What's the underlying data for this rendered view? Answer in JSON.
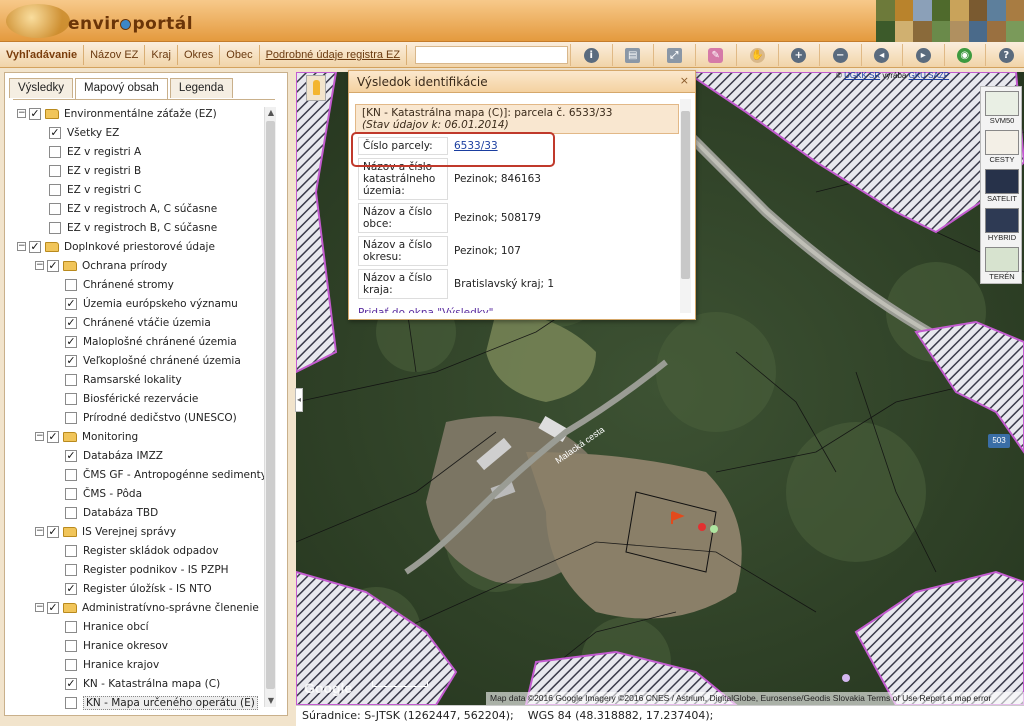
{
  "header": {
    "logo_text_a": "envir",
    "logo_text_b": "portál"
  },
  "toolbar": {
    "tabs": [
      {
        "label": "Vyhľadávanie",
        "style": "bold"
      },
      {
        "label": "Názov EZ",
        "style": ""
      },
      {
        "label": "Kraj",
        "style": ""
      },
      {
        "label": "Okres",
        "style": ""
      },
      {
        "label": "Obec",
        "style": ""
      },
      {
        "label": "Podrobné údaje registra EZ",
        "style": "ul"
      }
    ],
    "search_value": "",
    "tools": [
      {
        "name": "info-icon",
        "glyph": "i",
        "cls": ""
      },
      {
        "name": "print-icon",
        "glyph": "▤",
        "cls": "sq"
      },
      {
        "name": "full-extent-icon",
        "glyph": "⤢",
        "cls": "sq"
      },
      {
        "name": "eraser-icon",
        "glyph": "✎",
        "cls": "pen"
      },
      {
        "name": "pan-hand-icon",
        "glyph": "✋",
        "cls": "hand"
      },
      {
        "name": "zoom-in-icon",
        "glyph": "+",
        "cls": ""
      },
      {
        "name": "zoom-out-icon",
        "glyph": "−",
        "cls": ""
      },
      {
        "name": "zoom-previous-icon",
        "glyph": "◂",
        "cls": ""
      },
      {
        "name": "zoom-next-icon",
        "glyph": "▸",
        "cls": ""
      },
      {
        "name": "globe-icon",
        "glyph": "◉",
        "cls": "gr"
      },
      {
        "name": "help-icon",
        "glyph": "?",
        "cls": ""
      }
    ]
  },
  "left_panel": {
    "tabs": [
      {
        "label": "Výsledky",
        "active": false
      },
      {
        "label": "Mapový obsah",
        "active": true
      },
      {
        "label": "Legenda",
        "active": false
      }
    ],
    "tree": [
      {
        "label": "Environmentálne záťaže (EZ)",
        "level": 0,
        "expander": "−",
        "checked": true,
        "folder": true
      },
      {
        "label": "Všetky EZ",
        "level": 1,
        "checked": true
      },
      {
        "label": "EZ v registri A",
        "level": 1,
        "checked": false
      },
      {
        "label": "EZ v registri B",
        "level": 1,
        "checked": false
      },
      {
        "label": "EZ v registri C",
        "level": 1,
        "checked": false
      },
      {
        "label": "EZ v registroch A, C súčasne",
        "level": 1,
        "checked": false
      },
      {
        "label": "EZ v registroch B, C súčasne",
        "level": 1,
        "checked": false
      },
      {
        "label": "Doplnkové priestorové údaje",
        "level": 0,
        "expander": "−",
        "checked": true,
        "folder": true
      },
      {
        "label": "Ochrana prírody",
        "level": 1,
        "expander": "−",
        "checked": true,
        "folder": true
      },
      {
        "label": "Chránené stromy",
        "level": 2,
        "checked": false
      },
      {
        "label": "Územia európskeho významu",
        "level": 2,
        "checked": true
      },
      {
        "label": "Chránené vtáčie územia",
        "level": 2,
        "checked": true
      },
      {
        "label": "Maloplošné chránené územia",
        "level": 2,
        "checked": true
      },
      {
        "label": "Veľkoplošné chránené územia",
        "level": 2,
        "checked": true
      },
      {
        "label": "Ramsarské lokality",
        "level": 2,
        "checked": false
      },
      {
        "label": "Biosférické rezervácie",
        "level": 2,
        "checked": false
      },
      {
        "label": "Prírodné dedičstvo (UNESCO)",
        "level": 2,
        "checked": false
      },
      {
        "label": "Monitoring",
        "level": 1,
        "expander": "−",
        "checked": true,
        "folder": true
      },
      {
        "label": "Databáza IMZZ",
        "level": 2,
        "checked": true
      },
      {
        "label": "ČMS GF - Antropogénne sedimenty",
        "level": 2,
        "checked": false
      },
      {
        "label": "ČMS - Pôda",
        "level": 2,
        "checked": false
      },
      {
        "label": "Databáza TBD",
        "level": 2,
        "checked": false
      },
      {
        "label": "IS Verejnej správy",
        "level": 1,
        "expander": "−",
        "checked": true,
        "folder": true
      },
      {
        "label": "Register skládok odpadov",
        "level": 2,
        "checked": false
      },
      {
        "label": "Register podnikov - IS PZPH",
        "level": 2,
        "checked": false
      },
      {
        "label": "Register úložísk - IS NTO",
        "level": 2,
        "checked": true
      },
      {
        "label": "Administratívno-správne členenie",
        "level": 1,
        "expander": "−",
        "checked": true,
        "folder": true
      },
      {
        "label": "Hranice obcí",
        "level": 2,
        "checked": false
      },
      {
        "label": "Hranice okresov",
        "level": 2,
        "checked": false
      },
      {
        "label": "Hranice krajov",
        "level": 2,
        "checked": false
      },
      {
        "label": "KN - Katastrálna mapa (C)",
        "level": 2,
        "checked": true
      },
      {
        "label": "KN - Mapa určeného operátu (E)",
        "level": 2,
        "checked": false,
        "selected": true
      }
    ]
  },
  "popup": {
    "title": "Výsledok identifikácie",
    "close": "×",
    "layer_header": "[KN - Katastrálna mapa (C)]: parcela č. 6533/33",
    "layer_status": "(Stav údajov k: 06.01.2014)",
    "rows": [
      {
        "key": "Číslo parcely:",
        "value": "6533/33",
        "link": true
      },
      {
        "key": "Názov a číslo katastrálneho územia:",
        "value": "Pezinok; 846163"
      },
      {
        "key": "Názov a číslo obce:",
        "value": "Pezinok; 508179"
      },
      {
        "key": "Názov a číslo okresu:",
        "value": "Pezinok; 107"
      },
      {
        "key": "Názov a číslo kraja:",
        "value": "Bratislavský kraj; 1"
      }
    ],
    "add_link": "Pridať do okna \"Výsledky\""
  },
  "map": {
    "copyright_prefix": "© ",
    "copyright_link_a": "ÚGKK SR",
    "copyright_mid": " vyrába ",
    "copyright_link_b": "GKÚ SAŽP",
    "road_label": "Malacká cesta",
    "road_number": "503",
    "google": "Google",
    "attribution": "Map data ©2016 Google Imagery ©2016 CNES / Astrium, DigitalGlobe, Eurosense/Geodis Slovakia   Terms of Use   Report a map error",
    "map_types": [
      {
        "label": "SVM50"
      },
      {
        "label": "CESTY"
      },
      {
        "label": "SATELIT"
      },
      {
        "label": "HYBRID"
      },
      {
        "label": "TERÉN"
      }
    ]
  },
  "statusbar": {
    "coords": "Súradnice: S-JTSK (1262447, 562204);    WGS 84 (48.318882, 17.237404);"
  }
}
